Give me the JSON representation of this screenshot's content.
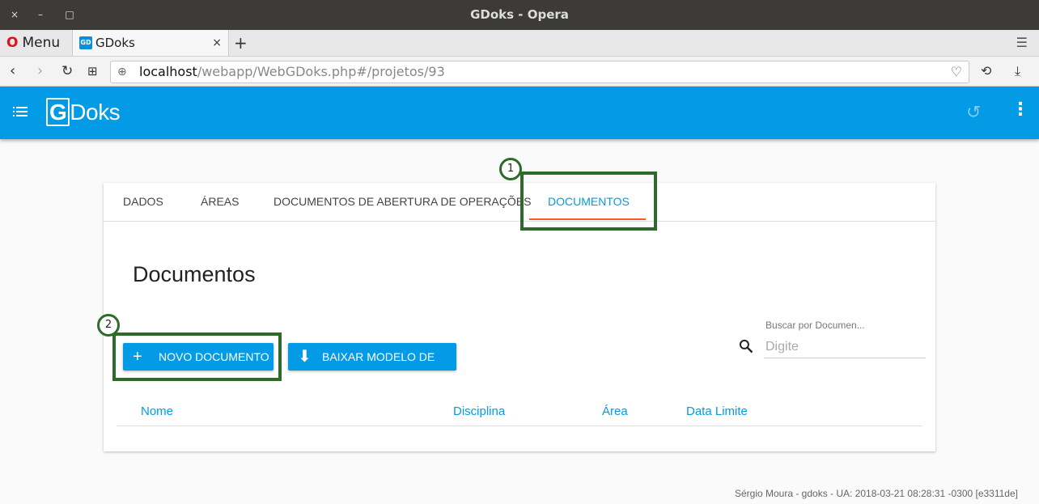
{
  "window": {
    "title": "GDoks - Opera",
    "close": "×",
    "minimize": "–",
    "maximize": "□"
  },
  "browser": {
    "menu_label": "Menu",
    "tab_title": "GDoks",
    "tab_close": "×",
    "new_tab": "+",
    "url_host": "localhost",
    "url_path": "/webapp/WebGDoks.php#/projetos/93"
  },
  "app": {
    "logo_g": "G",
    "logo_rest": "Doks",
    "tabs": [
      {
        "label": "DADOS"
      },
      {
        "label": "ÁREAS"
      },
      {
        "label": "DOCUMENTOS DE ABERTURA DE OPERAÇÕES"
      },
      {
        "label": "DOCUMENTOS"
      }
    ],
    "page_title": "Documentos",
    "new_doc_button": "NOVO DOCUMENTO",
    "download_button": "BAIXAR MODELO DE LDP",
    "search_label": "Buscar por Documen...",
    "search_placeholder": "Digite",
    "columns": [
      "Nome",
      "Disciplina",
      "Área",
      "Data Limite"
    ],
    "annotations": [
      "1",
      "2"
    ]
  },
  "footer": "Sérgio Moura - gdoks - UA: 2018-03-21 08:28:31 -0300 [e3311de]",
  "colors": {
    "primary": "#039be5",
    "ink": "#ff5722",
    "highlight": "#2e6b2b"
  }
}
